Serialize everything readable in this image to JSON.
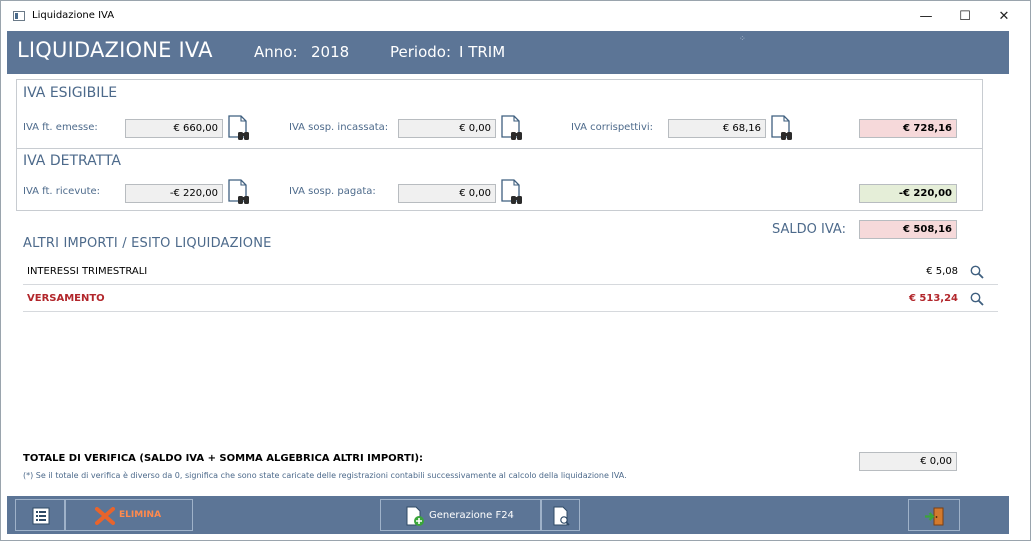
{
  "window": {
    "title": "Liquidazione IVA",
    "minimize": "—",
    "maximize": "☐",
    "close": "✕"
  },
  "header": {
    "title": "LIQUIDAZIONE IVA",
    "anno_label": "Anno:",
    "anno_value": "2018",
    "periodo_label": "Periodo:",
    "periodo_value": "I TRIM"
  },
  "esigibile": {
    "title": "IVA ESIGIBILE",
    "ft_emesse_label": "IVA ft. emesse:",
    "ft_emesse_value": "€ 660,00",
    "sosp_incassata_label": "IVA sosp. incassata:",
    "sosp_incassata_value": "€ 0,00",
    "corrispettivi_label": "IVA  corrispettivi:",
    "corrispettivi_value": "€ 68,16",
    "total": "€ 728,16"
  },
  "detratta": {
    "title": "IVA DETRATTA",
    "ft_ricevute_label": "IVA ft. ricevute:",
    "ft_ricevute_value": "-€ 220,00",
    "sosp_pagata_label": "IVA sosp. pagata:",
    "sosp_pagata_value": "€ 0,00",
    "total": "-€ 220,00"
  },
  "saldo": {
    "label": "SALDO IVA:",
    "value": "€ 508,16"
  },
  "altri": {
    "title": "ALTRI IMPORTI / ESITO LIQUIDAZIONE",
    "rows": [
      {
        "label": "INTERESSI TRIMESTRALI",
        "value": "€ 5,08"
      },
      {
        "label": "VERSAMENTO",
        "value": "€ 513,24"
      }
    ]
  },
  "verifica": {
    "label": "TOTALE DI VERIFICA  (SALDO IVA + SOMMA ALGEBRICA ALTRI IMPORTI):",
    "value": "€ 0,00",
    "note": "(*) Se il totale di verifica è diverso da 0, significa che sono state caricate delle registrazioni contabili successivamente al calcolo della liquidazione IVA."
  },
  "footer": {
    "elimina_label": "ELIMINA",
    "generazione_label": "Generazione F24"
  },
  "colors": {
    "header": "#5c7596",
    "label": "#4d6a8b",
    "red_field": "#f6d9da",
    "green_field": "#e5eed8",
    "versamento": "#b2262b",
    "elimina_icon": "#e8642c"
  },
  "icons": {
    "doc": "document-binoculars-icon",
    "search": "magnifier-icon",
    "list": "list-icon",
    "delete": "x-delete-icon",
    "f24": "document-add-icon",
    "preview": "document-preview-icon",
    "exit": "exit-door-icon"
  }
}
